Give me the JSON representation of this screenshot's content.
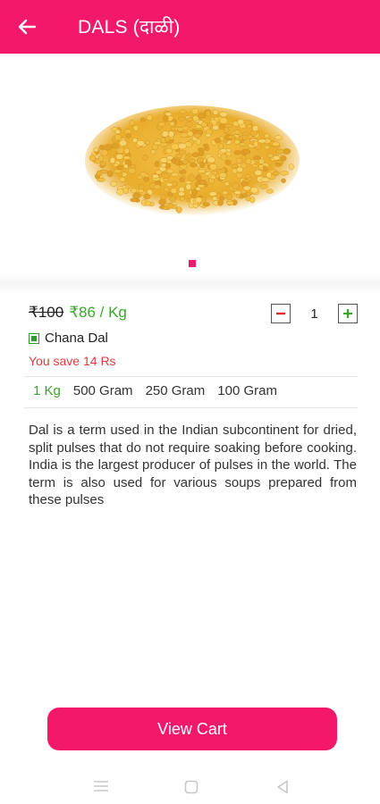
{
  "header": {
    "title": "DALS (दाळी)"
  },
  "product": {
    "mrp": "₹100",
    "price": "₹86 / Kg",
    "name": "Chana Dal",
    "savings": "You save 14 Rs",
    "quantity": "1",
    "variants": [
      "1 Kg",
      "500 Gram",
      "250 Gram",
      "100 Gram"
    ],
    "selected_variant": "1 Kg",
    "description": "Dal is a term used in the Indian subcontinent for dried, split pulses that do not require soaking before cooking. India is the largest producer of pulses in the world. The term is also used for various soups prepared from these pulses"
  },
  "cart": {
    "button_label": "View Cart"
  },
  "colors": {
    "brand": "#f2196b",
    "price_green": "#3aa52b",
    "save_red": "#e23b3b"
  },
  "icons": {
    "back": "arrow-left-icon",
    "minus": "minus-icon",
    "plus": "plus-icon",
    "veg": "veg-indicator-icon",
    "nav": [
      "menu-icon",
      "home-square-icon",
      "back-triangle-icon"
    ]
  }
}
